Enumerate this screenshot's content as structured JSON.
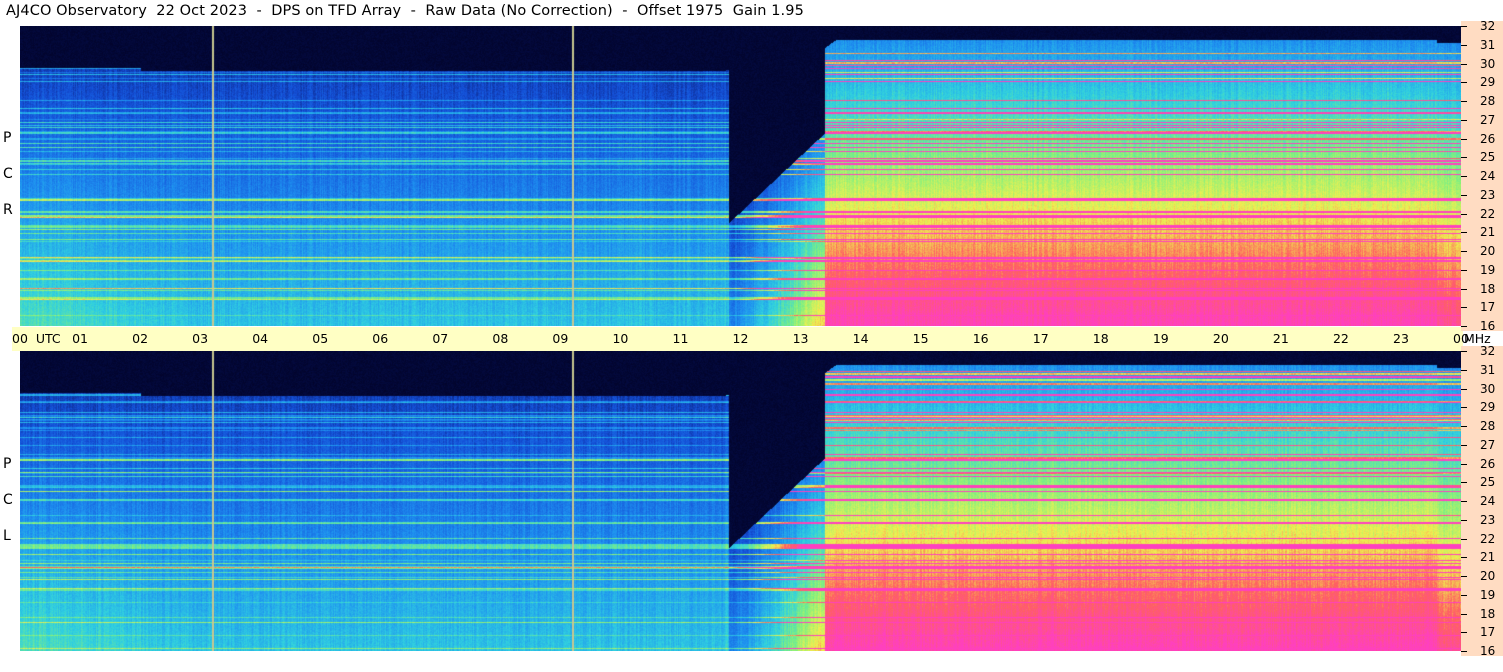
{
  "title": "AJ4CO Observatory  22 Oct 2023  -  DPS on TFD Array  -  Raw Data (No Correction)  -  Offset 1975  Gain 1.95",
  "panels": [
    {
      "id": "top",
      "polarization": "RCP",
      "letters": [
        "P",
        "C",
        "R"
      ]
    },
    {
      "id": "bottom",
      "polarization": "LCP",
      "letters": [
        "P",
        "C",
        "L"
      ]
    }
  ],
  "time_axis": {
    "labels": [
      "00  UTC",
      "01",
      "02",
      "03",
      "04",
      "05",
      "06",
      "07",
      "08",
      "09",
      "10",
      "11",
      "12",
      "13",
      "14",
      "15",
      "16",
      "17",
      "18",
      "19",
      "20",
      "21",
      "22",
      "23",
      "00"
    ],
    "unit": "MHz"
  },
  "freq_axis": {
    "labels": [
      "32",
      "31",
      "30",
      "29",
      "28",
      "27",
      "26",
      "25",
      "24",
      "23",
      "22",
      "21",
      "20",
      "19",
      "18",
      "17",
      "16"
    ]
  },
  "chart_data": {
    "type": "heatmap",
    "title": "AJ4CO Observatory  22 Oct 2023  -  DPS on TFD Array  -  Raw Data (No Correction)  -  Offset 1975  Gain 1.95",
    "x": {
      "label": "UTC",
      "range_hours": [
        0,
        24
      ],
      "ticks": [
        "00",
        "01",
        "02",
        "03",
        "04",
        "05",
        "06",
        "07",
        "08",
        "09",
        "10",
        "11",
        "12",
        "13",
        "14",
        "15",
        "16",
        "17",
        "18",
        "19",
        "20",
        "21",
        "22",
        "23",
        "00"
      ]
    },
    "y": {
      "label": "MHz",
      "range": [
        16,
        32
      ],
      "ticks": [
        32,
        31,
        30,
        29,
        28,
        27,
        26,
        25,
        24,
        23,
        22,
        21,
        20,
        19,
        18,
        17,
        16
      ]
    },
    "panels": [
      "RCP",
      "LCP"
    ],
    "vertical_markers_utc_hours": [
      3.2,
      9.2
    ],
    "colormap": [
      "#000020",
      "#0a1a6e",
      "#1450d8",
      "#1e90f0",
      "#30d0e0",
      "#80f080",
      "#f0f050",
      "#ff6060",
      "#ff40c0"
    ],
    "daytime_high_signal_utc": [
      12.5,
      23.5
    ]
  }
}
